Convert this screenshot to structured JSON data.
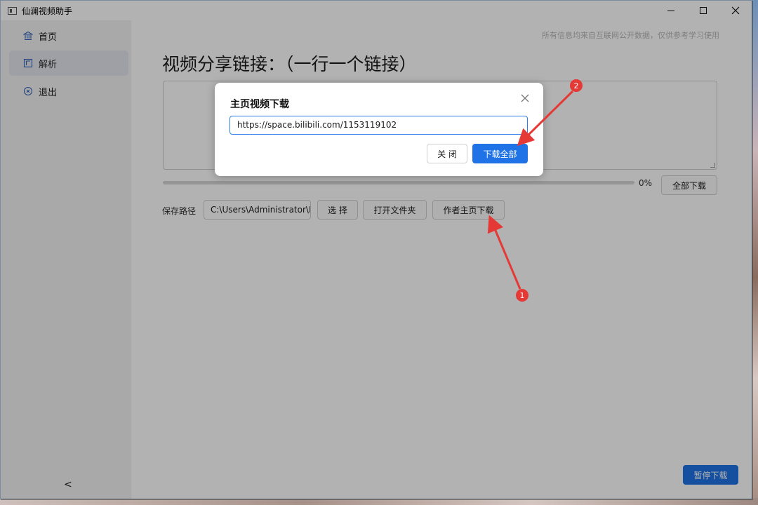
{
  "window": {
    "title": "仙澜视频助手",
    "controls": [
      "minimize",
      "maximize",
      "close"
    ]
  },
  "sidebar": {
    "items": [
      {
        "label": "首页",
        "icon": "bank-icon",
        "active": false
      },
      {
        "label": "解析",
        "icon": "panel-icon",
        "active": true
      },
      {
        "label": "退出",
        "icon": "circle-x-icon",
        "active": false
      }
    ],
    "collapse_glyph": "<"
  },
  "main": {
    "notice": "所有信息均来自互联网公开数据，仅供参考学习使用",
    "heading": "视频分享链接：（一行一个链接）",
    "textarea_value": "",
    "progress": {
      "percent": 0,
      "label": "0%"
    },
    "download_all_label": "全部下载",
    "save_path_label": "保存路径",
    "save_path_value": "C:\\Users\\Administrator\\D",
    "choose_label": "选 择",
    "open_folder_label": "打开文件夹",
    "author_download_label": "作者主页下载",
    "pause_label": "暂停下载"
  },
  "dialog": {
    "title": "主页视频下载",
    "input_value": "https://space.bilibili.com/1153119102",
    "cancel_label": "关 闭",
    "confirm_label": "下载全部"
  },
  "annotations": {
    "markers": [
      {
        "label": "1",
        "color": "#e53935"
      },
      {
        "label": "2",
        "color": "#e53935"
      }
    ]
  },
  "colors": {
    "accent": "#1f73e6",
    "annotation": "#e53935",
    "sidebar_bg": "#f3f3f3"
  }
}
